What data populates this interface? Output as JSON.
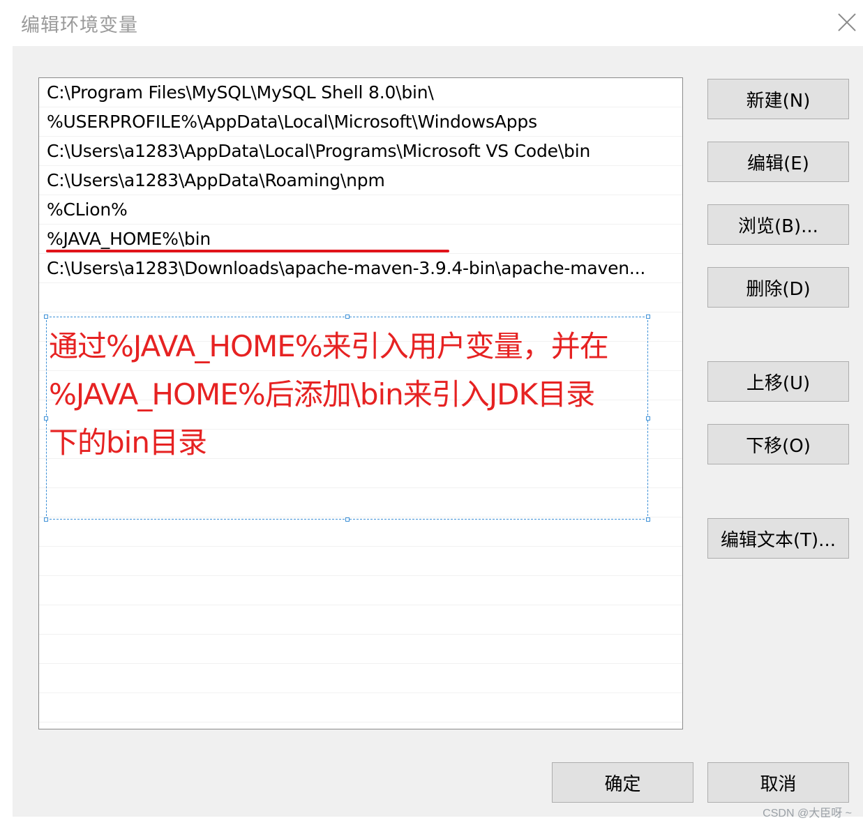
{
  "dialog": {
    "title": "编辑环境变量"
  },
  "path_list": {
    "items": [
      "C:\\Program Files\\MySQL\\MySQL Shell 8.0\\bin\\",
      "%USERPROFILE%\\AppData\\Local\\Microsoft\\WindowsApps",
      "C:\\Users\\a1283\\AppData\\Local\\Programs\\Microsoft VS Code\\bin",
      "C:\\Users\\a1283\\AppData\\Roaming\\npm",
      "%CLion%",
      "%JAVA_HOME%\\bin",
      "C:\\Users\\a1283\\Downloads\\apache-maven-3.9.4-bin\\apache-maven..."
    ],
    "highlighted_item": "%JAVA_HOME%\\bin"
  },
  "annotation": {
    "lines": [
      "通过%JAVA_HOME%来引入用户变量，并在",
      "%JAVA_HOME%后添加\\bin来引入JDK目录",
      "下的bin目录"
    ],
    "color": "#e62222"
  },
  "buttons": {
    "new": "新建(N)",
    "edit": "编辑(E)",
    "browse": "浏览(B)...",
    "delete": "删除(D)",
    "move_up": "上移(U)",
    "move_down": "下移(O)",
    "edit_text": "编辑文本(T)...",
    "ok": "确定",
    "cancel": "取消"
  },
  "watermark": "CSDN @大臣呀 ~"
}
